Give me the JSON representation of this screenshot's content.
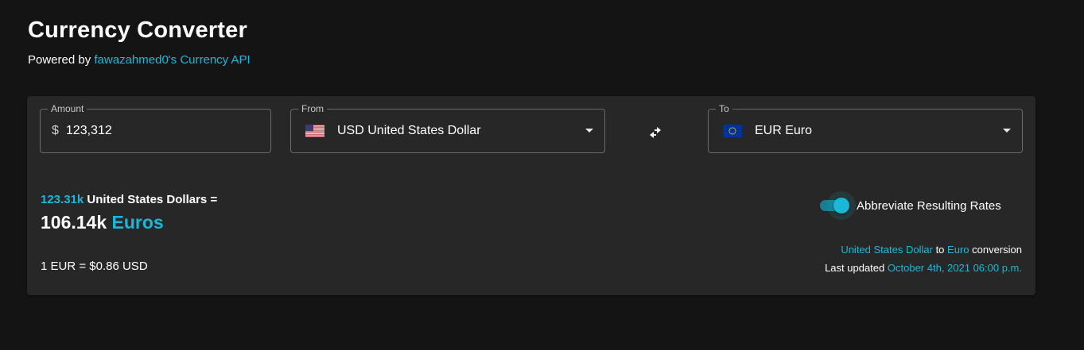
{
  "header": {
    "title": "Currency Converter",
    "powered_prefix": "Powered by",
    "api_link": "fawazahmed0's Currency API"
  },
  "amount": {
    "label": "Amount",
    "currency_symbol": "$",
    "value": "123,312"
  },
  "from": {
    "label": "From",
    "code": "USD",
    "name": "United States Dollar",
    "flag_icon": "us-flag-icon"
  },
  "to": {
    "label": "To",
    "code": "EUR",
    "name": "Euro",
    "flag_icon": "eu-flag-icon"
  },
  "swap": {
    "icon": "swap-arrows-icon"
  },
  "result": {
    "input_amount": "123.31k",
    "input_currency_text": "United States Dollars =",
    "output_amount": "106.14k",
    "output_currency": "Euros",
    "rate_text": "1 EUR = $0.86 USD"
  },
  "toggle": {
    "label": "Abbreviate Resulting Rates",
    "checked": true
  },
  "info": {
    "from_name": "United States Dollar",
    "to_word": "to",
    "to_name": "Euro",
    "conversion_word": "conversion",
    "updated_prefix": "Last updated",
    "updated_date": "October 4th, 2021 06:00 p.m."
  },
  "colors": {
    "background": "#141414",
    "card": "#272727",
    "accent": "#1ab8d6"
  }
}
